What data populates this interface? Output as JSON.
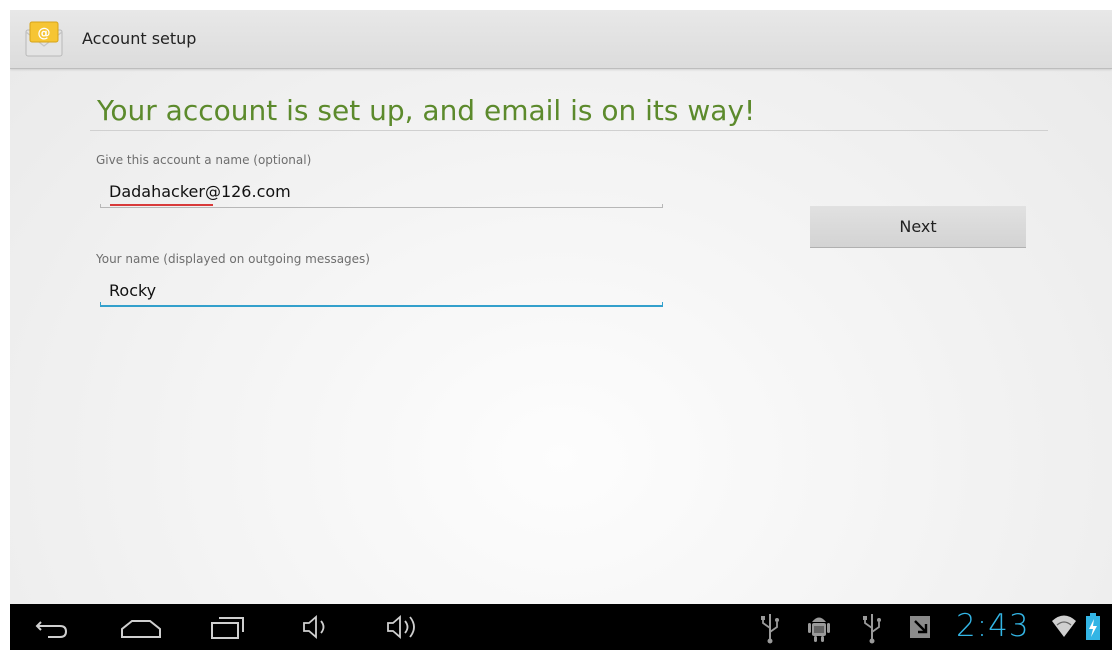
{
  "app": {
    "title": "Account setup",
    "icon": "email-app-icon",
    "icon_symbol": "@"
  },
  "content": {
    "headline": "Your account is set up, and email is on its way!",
    "account_name": {
      "label": "Give this account a name (optional)",
      "value": "Dadahacker@126.com"
    },
    "your_name": {
      "label": "Your name (displayed on outgoing messages)",
      "value": "Rocky"
    },
    "next_label": "Next"
  },
  "system_bar": {
    "clock": "2:43",
    "nav_icons": [
      "back-icon",
      "home-icon",
      "recent-apps-icon",
      "volume-down-icon",
      "volume-up-icon"
    ],
    "status_icons": [
      "usb-icon",
      "android-debug-icon",
      "usb-icon",
      "download-icon",
      "wifi-icon",
      "battery-charging-icon"
    ]
  },
  "colors": {
    "headline": "#5c8a2c",
    "focus_accent": "#33a0cc",
    "clock": "#33b5e5",
    "spellcheck": "#d83a3a"
  }
}
